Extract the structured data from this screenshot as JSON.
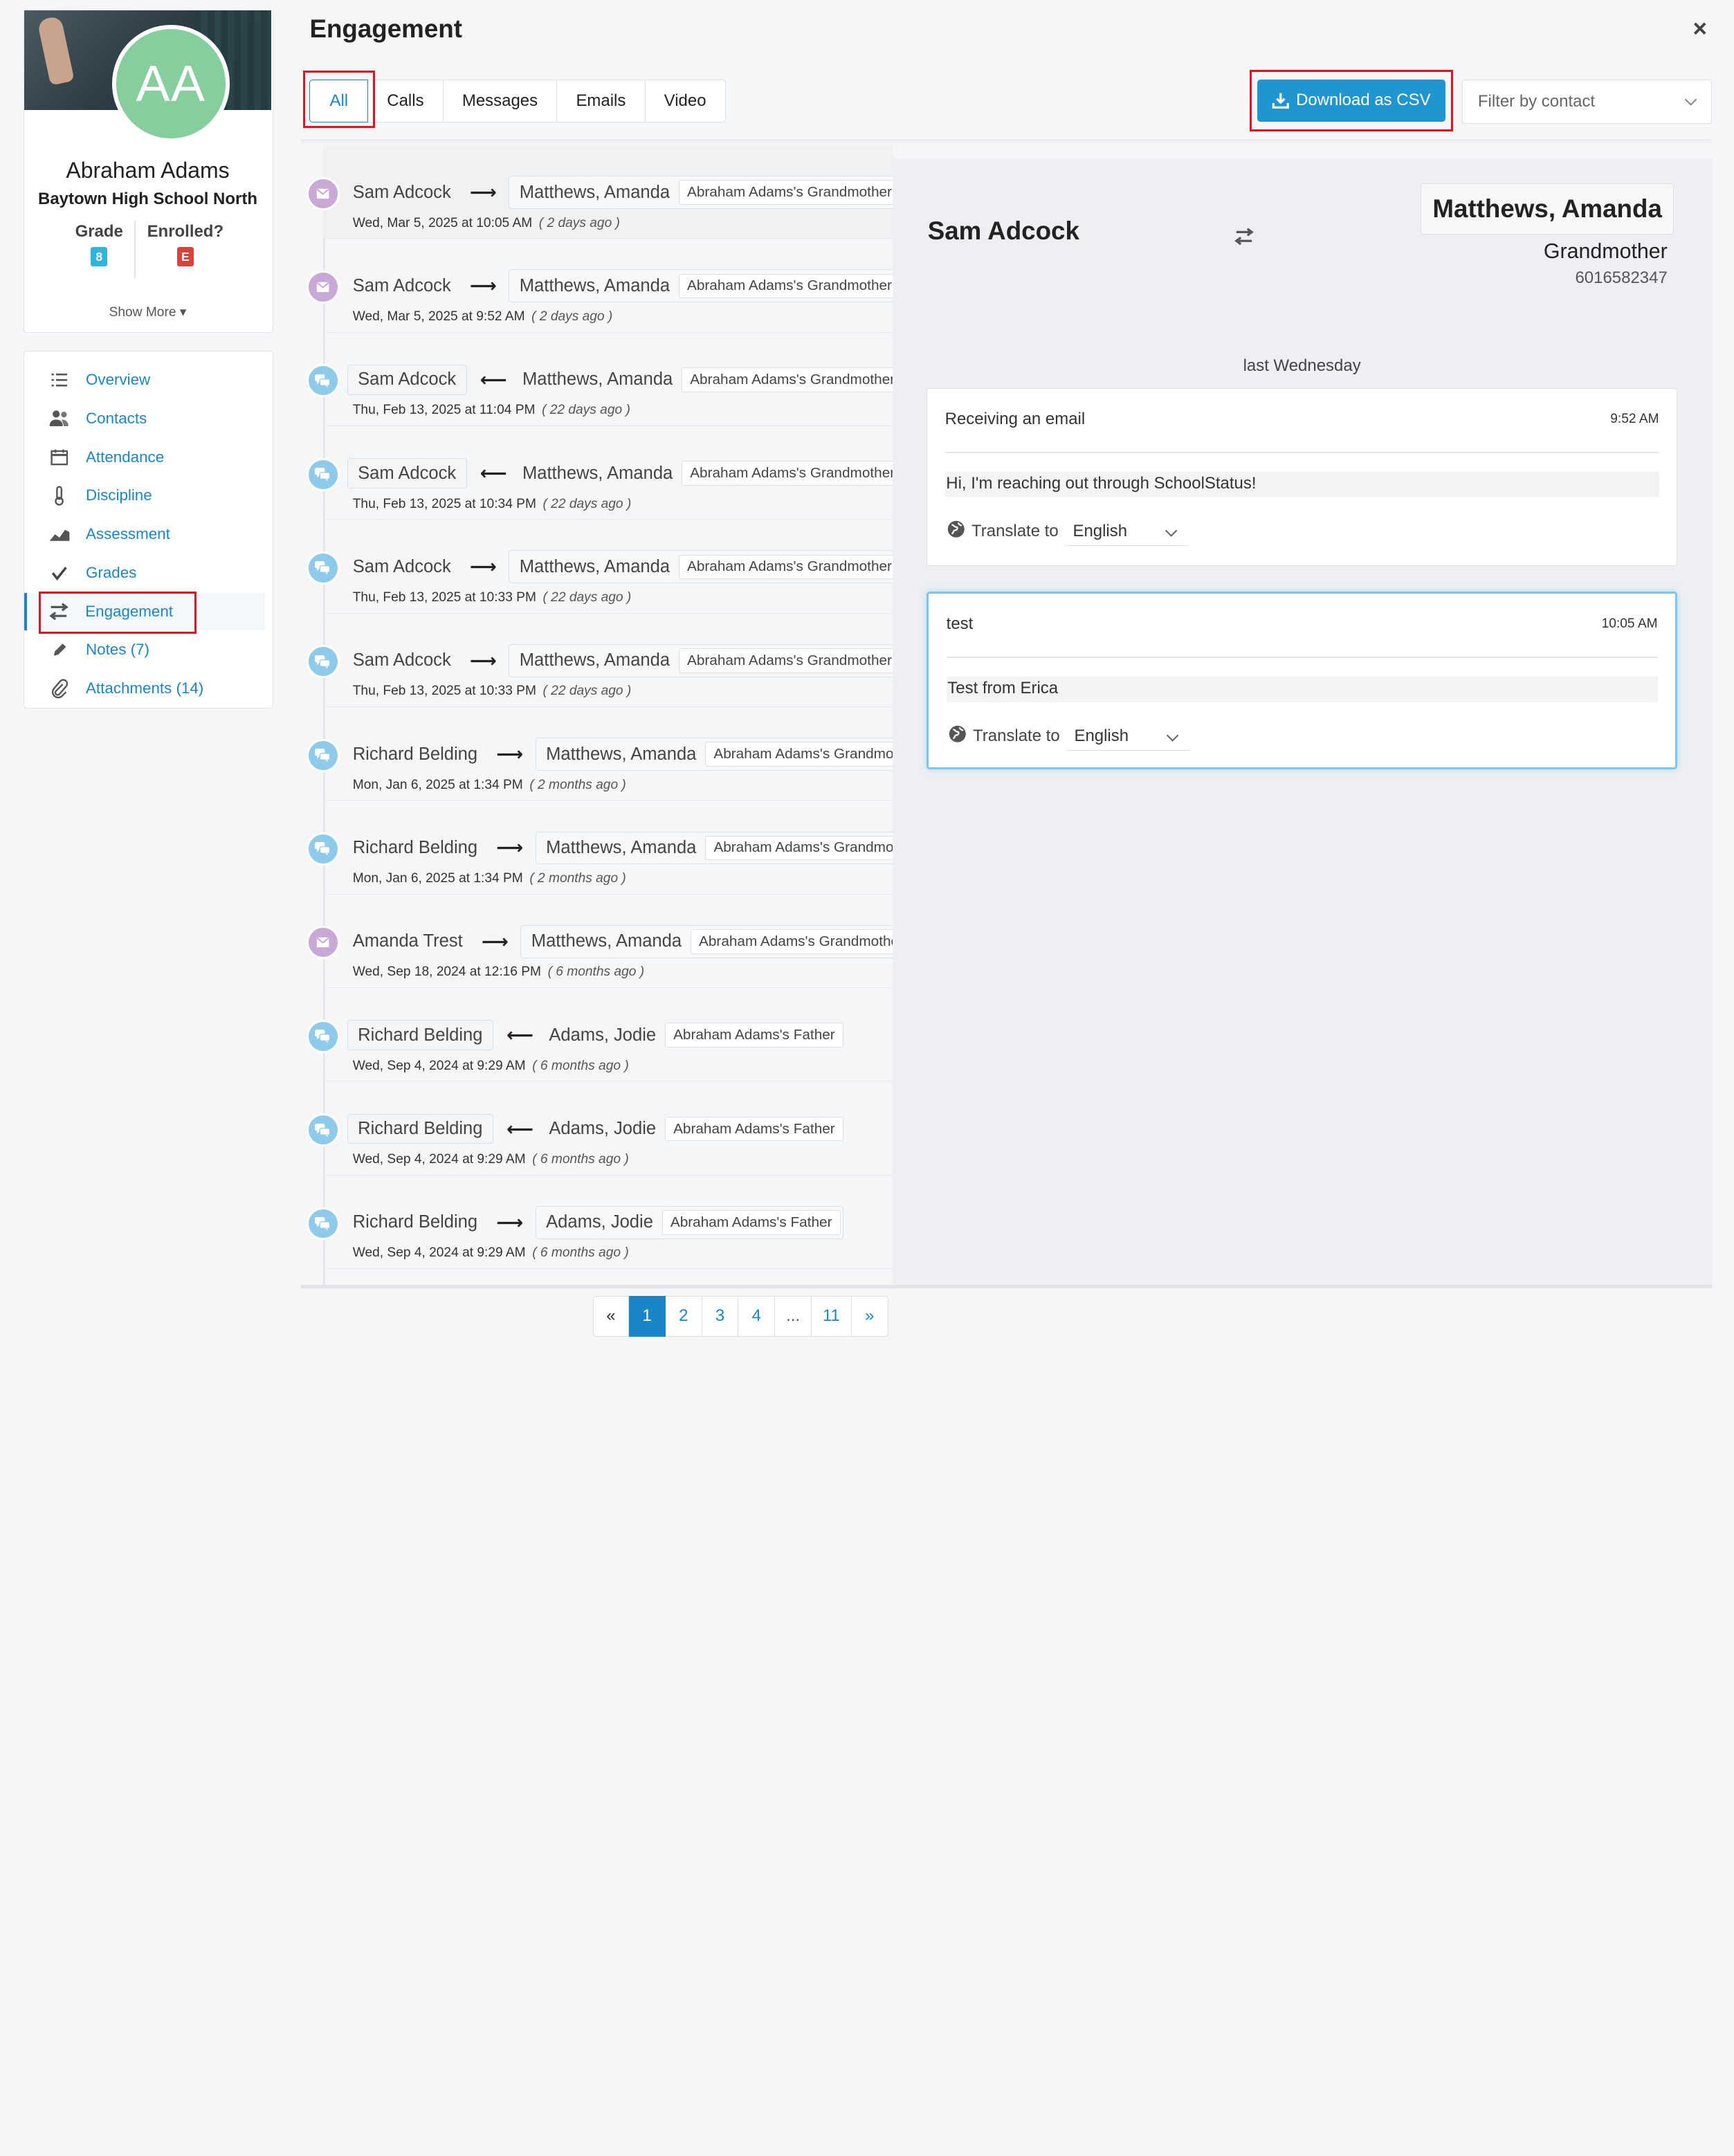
{
  "page": {
    "title": "Engagement",
    "close_label": "×"
  },
  "student": {
    "initials": "AA",
    "name": "Abraham Adams",
    "school": "Baytown High School North",
    "grade_label": "Grade",
    "grade_value": "8",
    "enrolled_label": "Enrolled?",
    "enrolled_value": "E",
    "show_more_label": "Show More ▾"
  },
  "nav": {
    "items": [
      {
        "label": "Overview",
        "icon": "list-icon"
      },
      {
        "label": "Contacts",
        "icon": "users-icon"
      },
      {
        "label": "Attendance",
        "icon": "calendar-icon"
      },
      {
        "label": "Discipline",
        "icon": "thermometer-icon"
      },
      {
        "label": "Assessment",
        "icon": "area-chart-icon"
      },
      {
        "label": "Grades",
        "icon": "check-icon"
      },
      {
        "label": "Engagement",
        "icon": "swap-arrows-icon",
        "active": true
      },
      {
        "label": "Notes (7)",
        "icon": "pencil-icon"
      },
      {
        "label": "Attachments (14)",
        "icon": "paperclip-icon"
      }
    ]
  },
  "tabs": [
    {
      "label": "All",
      "active": true
    },
    {
      "label": "Calls"
    },
    {
      "label": "Messages"
    },
    {
      "label": "Emails"
    },
    {
      "label": "Video"
    }
  ],
  "toolbar": {
    "csv_label": "Download as CSV",
    "filter_placeholder": "Filter by contact"
  },
  "list": [
    {
      "type": "email",
      "sender": "Sam Adcock",
      "direction": "out",
      "contact": "Matthews, Amanda",
      "relation": "Abraham Adams's Grandmother",
      "date": "Wed, Mar 5, 2025 at 10:05 AM",
      "ago": "( 2 days ago )",
      "selected": true
    },
    {
      "type": "email",
      "sender": "Sam Adcock",
      "direction": "out",
      "contact": "Matthews, Amanda",
      "relation": "Abraham Adams's Grandmother",
      "date": "Wed, Mar 5, 2025 at 9:52 AM",
      "ago": "( 2 days ago )"
    },
    {
      "type": "msg",
      "sender": "Sam Adcock",
      "direction": "in",
      "contact": "Matthews, Amanda",
      "relation": "Abraham Adams's Grandmother",
      "date": "Thu, Feb 13, 2025 at 11:04 PM",
      "ago": "( 22 days ago )"
    },
    {
      "type": "msg",
      "sender": "Sam Adcock",
      "direction": "in",
      "contact": "Matthews, Amanda",
      "relation": "Abraham Adams's Grandmother",
      "date": "Thu, Feb 13, 2025 at 10:34 PM",
      "ago": "( 22 days ago )"
    },
    {
      "type": "msg",
      "sender": "Sam Adcock",
      "direction": "out",
      "contact": "Matthews, Amanda",
      "relation": "Abraham Adams's Grandmother",
      "date": "Thu, Feb 13, 2025 at 10:33 PM",
      "ago": "( 22 days ago )"
    },
    {
      "type": "msg",
      "sender": "Sam Adcock",
      "direction": "out",
      "contact": "Matthews, Amanda",
      "relation": "Abraham Adams's Grandmother",
      "date": "Thu, Feb 13, 2025 at 10:33 PM",
      "ago": "( 22 days ago )"
    },
    {
      "type": "msg",
      "sender": "Richard Belding",
      "direction": "out",
      "contact": "Matthews, Amanda",
      "relation": "Abraham Adams's Grandmother",
      "date": "Mon, Jan 6, 2025 at 1:34 PM",
      "ago": "( 2 months ago )"
    },
    {
      "type": "msg",
      "sender": "Richard Belding",
      "direction": "out",
      "contact": "Matthews, Amanda",
      "relation": "Abraham Adams's Grandmother",
      "date": "Mon, Jan 6, 2025 at 1:34 PM",
      "ago": "( 2 months ago )"
    },
    {
      "type": "email",
      "sender": "Amanda Trest",
      "direction": "out",
      "contact": "Matthews, Amanda",
      "relation": "Abraham Adams's Grandmother",
      "date": "Wed, Sep 18, 2024 at 12:16 PM",
      "ago": "( 6 months ago )"
    },
    {
      "type": "msg",
      "sender": "Richard Belding",
      "direction": "in",
      "contact": "Adams, Jodie",
      "relation": "Abraham Adams's Father",
      "date": "Wed, Sep 4, 2024 at 9:29 AM",
      "ago": "( 6 months ago )"
    },
    {
      "type": "msg",
      "sender": "Richard Belding",
      "direction": "in",
      "contact": "Adams, Jodie",
      "relation": "Abraham Adams's Father",
      "date": "Wed, Sep 4, 2024 at 9:29 AM",
      "ago": "( 6 months ago )"
    },
    {
      "type": "msg",
      "sender": "Richard Belding",
      "direction": "out",
      "contact": "Adams, Jodie",
      "relation": "Abraham Adams's Father",
      "date": "Wed, Sep 4, 2024 at 9:29 AM",
      "ago": "( 6 months ago )"
    }
  ],
  "detail": {
    "sender": "Sam Adcock",
    "recipient": "Matthews, Amanda",
    "relation": "Grandmother",
    "phone": "6016582347",
    "day_label": "last Wednesday",
    "messages": [
      {
        "subject": "Receiving an email",
        "time": "9:52 AM",
        "body": "Hi, I'm reaching out through SchoolStatus!",
        "translate_label": "Translate to",
        "language": "English"
      },
      {
        "subject": "test",
        "time": "10:05 AM",
        "body": "Test from Erica",
        "translate_label": "Translate to",
        "language": "English",
        "focused": true
      }
    ]
  },
  "pagination": {
    "prev": "«",
    "pages": [
      "1",
      "2",
      "3",
      "4",
      "...",
      "11"
    ],
    "current": "1",
    "next": "»"
  },
  "colors": {
    "accent": "#1b86c6",
    "button": "#1f96cf",
    "highlight_box": "#e0141e",
    "email_dot": "#c7a8d6",
    "message_dot": "#8ecaea",
    "avatar": "#86ce9d"
  }
}
